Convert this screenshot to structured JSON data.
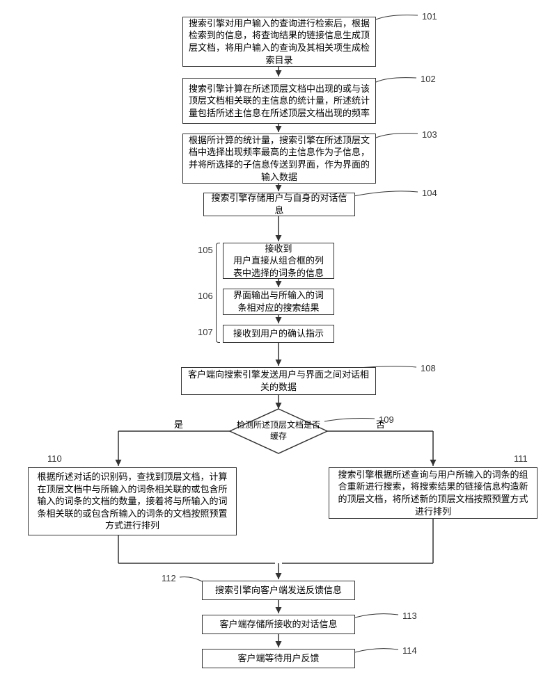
{
  "steps": {
    "s101": {
      "num": "101",
      "text": "搜索引擎对用户输入的查询进行检索后，根据检索到的信息，将查询结果的链接信息生成顶层文档，将用户输入的查询及其相关项生成检索目录"
    },
    "s102": {
      "num": "102",
      "text": "搜索引擎计算在所述顶层文档中出现的或与该顶层文档相关联的主信息的统计量，所述统计量包括所述主信息在所述顶层文档出现的频率"
    },
    "s103": {
      "num": "103",
      "text": "根据所计算的统计量，搜索引擎在所述顶层文档中选择出现频率最高的主信息作为子信息，并将所选择的子信息传送到界面，作为界面的输入数据"
    },
    "s104": {
      "num": "104",
      "text": "搜索引擎存储用户与自身的对话信息"
    },
    "s105": {
      "num": "105",
      "text": "接收到\n用户直接从组合框的列表中选择的词条的信息"
    },
    "s106": {
      "num": "106",
      "text": "界面输出与所输入的词条相对应的搜索结果"
    },
    "s107": {
      "num": "107",
      "text": "接收到用户的确认指示"
    },
    "s108": {
      "num": "108",
      "text": "客户端向搜索引擎发送用户与界面之间对话相关的数据"
    },
    "s109": {
      "num": "109",
      "text": "检测所述顶层文档是否缓存"
    },
    "s110": {
      "num": "110",
      "text": "根据所述对话的识别码，查找到顶层文档，计算在顶层文档中与所输入的词条相关联的或包含所输入的词条的文档的数量，接着将与所输入的词条相关联的或包含所输入的词条的文档按照预置方式进行排列"
    },
    "s111": {
      "num": "111",
      "text": "搜索引擎根据所述查询与用户所输入的词条的组合重新进行搜索，将搜索结果的链接信息构造新的顶层文档，将所述新的顶层文档按照预置方式进行排列"
    },
    "s112": {
      "num": "112",
      "text": "搜索引擎向客户端发送反馈信息"
    },
    "s113": {
      "num": "113",
      "text": "客户端存储所接收的对话信息"
    },
    "s114": {
      "num": "114",
      "text": "客户端等待用户反馈"
    }
  },
  "branch": {
    "yes": "是",
    "no": "否"
  }
}
